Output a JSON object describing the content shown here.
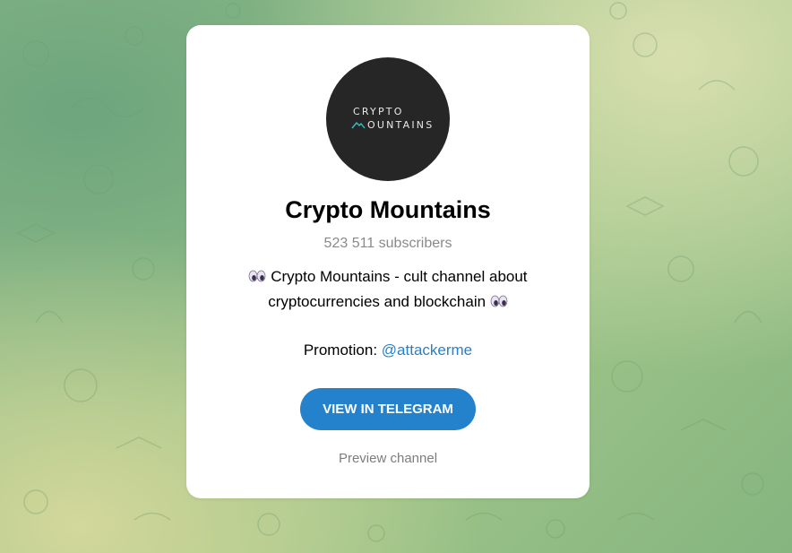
{
  "channel": {
    "avatar_text_line1": "CRYPTO",
    "avatar_text_line2": "OUNTAINS",
    "avatar_accent": "#36c1c7",
    "title": "Crypto Mountains",
    "subscribers": "523 511 subscribers",
    "description_part1": "Crypto Mountains - cult channel about",
    "description_part2": "cryptocurrencies and blockchain",
    "promotion_label": "Promotion:",
    "promotion_link": "@attackerme"
  },
  "actions": {
    "view_button": "VIEW IN TELEGRAM",
    "preview_link": "Preview channel"
  },
  "colors": {
    "accent": "#2481cc",
    "card": "#ffffff",
    "background": "#93bf86"
  },
  "icons": {
    "eyes": "eyes-emoji-icon",
    "mountain": "mountain-logo-icon"
  }
}
